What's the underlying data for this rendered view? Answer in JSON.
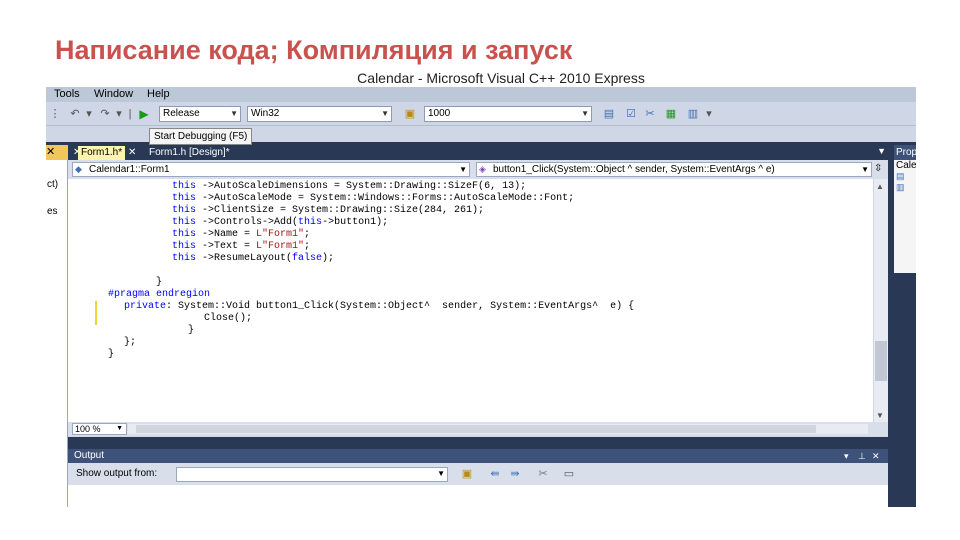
{
  "slide_title": "Написание кода; Компиляция и запуск",
  "window_title": "Calendar - Microsoft Visual C++ 2010 Express",
  "menu": [
    "Tools",
    "Window",
    "Help"
  ],
  "toolbar": {
    "config_value": "Release",
    "platform_value": "Win32",
    "find_value": "1000",
    "start_debugging_tooltip": "Start Debugging (F5)"
  },
  "left_panel": {
    "items": [
      "ct)",
      "es"
    ]
  },
  "right_panel": {
    "header": "Prop",
    "body": "Cale"
  },
  "tabs": [
    {
      "label": "Form1.h*",
      "active": true
    },
    {
      "label": "Form1.h [Design]*",
      "active": false
    }
  ],
  "navbar": {
    "class_combo": "Calendar1::Form1",
    "member_combo": "button1_Click(System::Object ^ sender, System::EventArgs ^ e)"
  },
  "code_lines": [
    {
      "indent": 4,
      "tokens": [
        [
          "kw",
          "this"
        ],
        [
          "t",
          " ->AutoScaleDimensions = System::Drawing::SizeF(6, 13);"
        ]
      ]
    },
    {
      "indent": 4,
      "tokens": [
        [
          "kw",
          "this"
        ],
        [
          "t",
          " ->AutoScaleMode = System::Windows::Forms::AutoScaleMode::Font;"
        ]
      ]
    },
    {
      "indent": 4,
      "tokens": [
        [
          "kw",
          "this"
        ],
        [
          "t",
          " ->ClientSize = System::Drawing::Size(284, 261);"
        ]
      ]
    },
    {
      "indent": 4,
      "tokens": [
        [
          "kw",
          "this"
        ],
        [
          "t",
          " ->Controls->Add("
        ],
        [
          "kw",
          "this"
        ],
        [
          "t",
          "->button1);"
        ]
      ]
    },
    {
      "indent": 4,
      "tokens": [
        [
          "kw",
          "this"
        ],
        [
          "t",
          " ->Name = "
        ],
        [
          "str",
          "L\"Form1\""
        ],
        [
          "t",
          ";"
        ]
      ]
    },
    {
      "indent": 4,
      "tokens": [
        [
          "kw",
          "this"
        ],
        [
          "t",
          " ->Text = "
        ],
        [
          "str",
          "L\"Form1\""
        ],
        [
          "t",
          ";"
        ]
      ]
    },
    {
      "indent": 4,
      "tokens": [
        [
          "kw",
          "this"
        ],
        [
          "t",
          " ->ResumeLayout("
        ],
        [
          "kw",
          "false"
        ],
        [
          "t",
          ");"
        ]
      ]
    },
    {
      "indent": 0,
      "tokens": [
        [
          "t",
          ""
        ]
      ]
    },
    {
      "indent": 3,
      "tokens": [
        [
          "t",
          "}"
        ]
      ]
    },
    {
      "indent": 0,
      "tokens": [
        [
          "pp",
          "#pragma endregion"
        ]
      ]
    },
    {
      "indent": 1,
      "tokens": [
        [
          "kw",
          "private"
        ],
        [
          "t",
          ": System::Void button1_Click(System::Object^  sender, System::EventArgs^  e) {"
        ]
      ]
    },
    {
      "indent": 6,
      "tokens": [
        [
          "t",
          "Close();"
        ]
      ]
    },
    {
      "indent": 5,
      "tokens": [
        [
          "t",
          "}"
        ]
      ]
    },
    {
      "indent": 1,
      "tokens": [
        [
          "t",
          "};"
        ]
      ]
    },
    {
      "indent": 0,
      "tokens": [
        [
          "t",
          "}"
        ]
      ]
    }
  ],
  "zoom": "100 %",
  "output": {
    "title": "Output",
    "show_output_from_label": "Show output from:",
    "show_output_from_value": ""
  }
}
